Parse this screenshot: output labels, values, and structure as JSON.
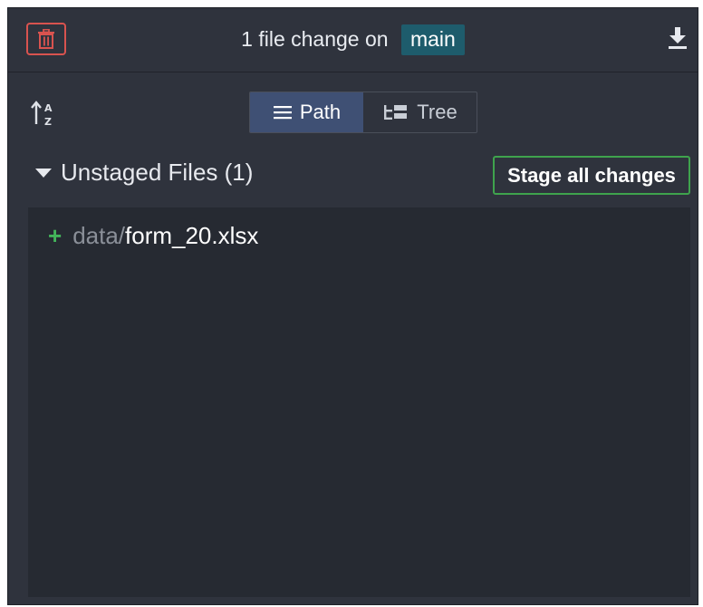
{
  "header": {
    "title_prefix": "1 file change on",
    "branch": "main",
    "trash_icon": "trash-icon",
    "download_icon": "download-icon"
  },
  "toolbar": {
    "sort_icon": "sort-alpha-icon",
    "view_toggle": [
      {
        "label": "Path",
        "icon": "list-icon",
        "active": true
      },
      {
        "label": "Tree",
        "icon": "tree-icon",
        "active": false
      }
    ]
  },
  "unstaged": {
    "title": "Unstaged Files (1)",
    "stage_all_label": "Stage all changes",
    "files": [
      {
        "status": "+",
        "dir": "data/",
        "name": "form_20.xlsx"
      }
    ]
  },
  "colors": {
    "panel": "#2f333d",
    "list": "#262a32",
    "branch_bg": "#1e5c6c",
    "active_toggle": "#3f5074",
    "danger": "#d9534f",
    "success": "#3fa34d"
  }
}
